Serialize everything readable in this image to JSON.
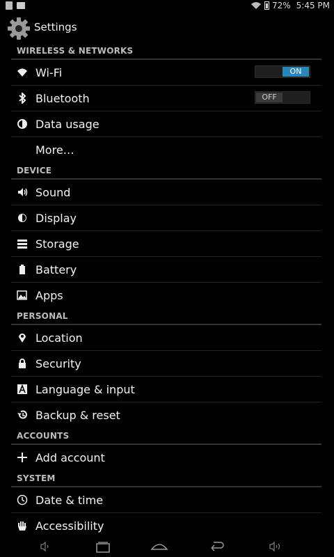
{
  "status_bar": {
    "battery": "72%",
    "time": "5:45 PM"
  },
  "action_bar": {
    "title": "Settings"
  },
  "sections": {
    "wireless": {
      "header": "WIRELESS & NETWORKS",
      "wifi": {
        "label": "Wi-Fi",
        "toggle": "ON"
      },
      "bluetooth": {
        "label": "Bluetooth",
        "toggle": "OFF"
      },
      "data_usage": {
        "label": "Data usage"
      },
      "more": {
        "label": "More…"
      }
    },
    "device": {
      "header": "DEVICE",
      "sound": {
        "label": "Sound"
      },
      "display": {
        "label": "Display"
      },
      "storage": {
        "label": "Storage"
      },
      "battery": {
        "label": "Battery"
      },
      "apps": {
        "label": "Apps"
      }
    },
    "personal": {
      "header": "PERSONAL",
      "location": {
        "label": "Location"
      },
      "security": {
        "label": "Security"
      },
      "language": {
        "label": "Language & input"
      },
      "backup": {
        "label": "Backup & reset"
      }
    },
    "accounts": {
      "header": "ACCOUNTS",
      "add_account": {
        "label": "Add account"
      }
    },
    "system": {
      "header": "SYSTEM",
      "date_time": {
        "label": "Date & time"
      },
      "accessibility": {
        "label": "Accessibility"
      }
    }
  }
}
